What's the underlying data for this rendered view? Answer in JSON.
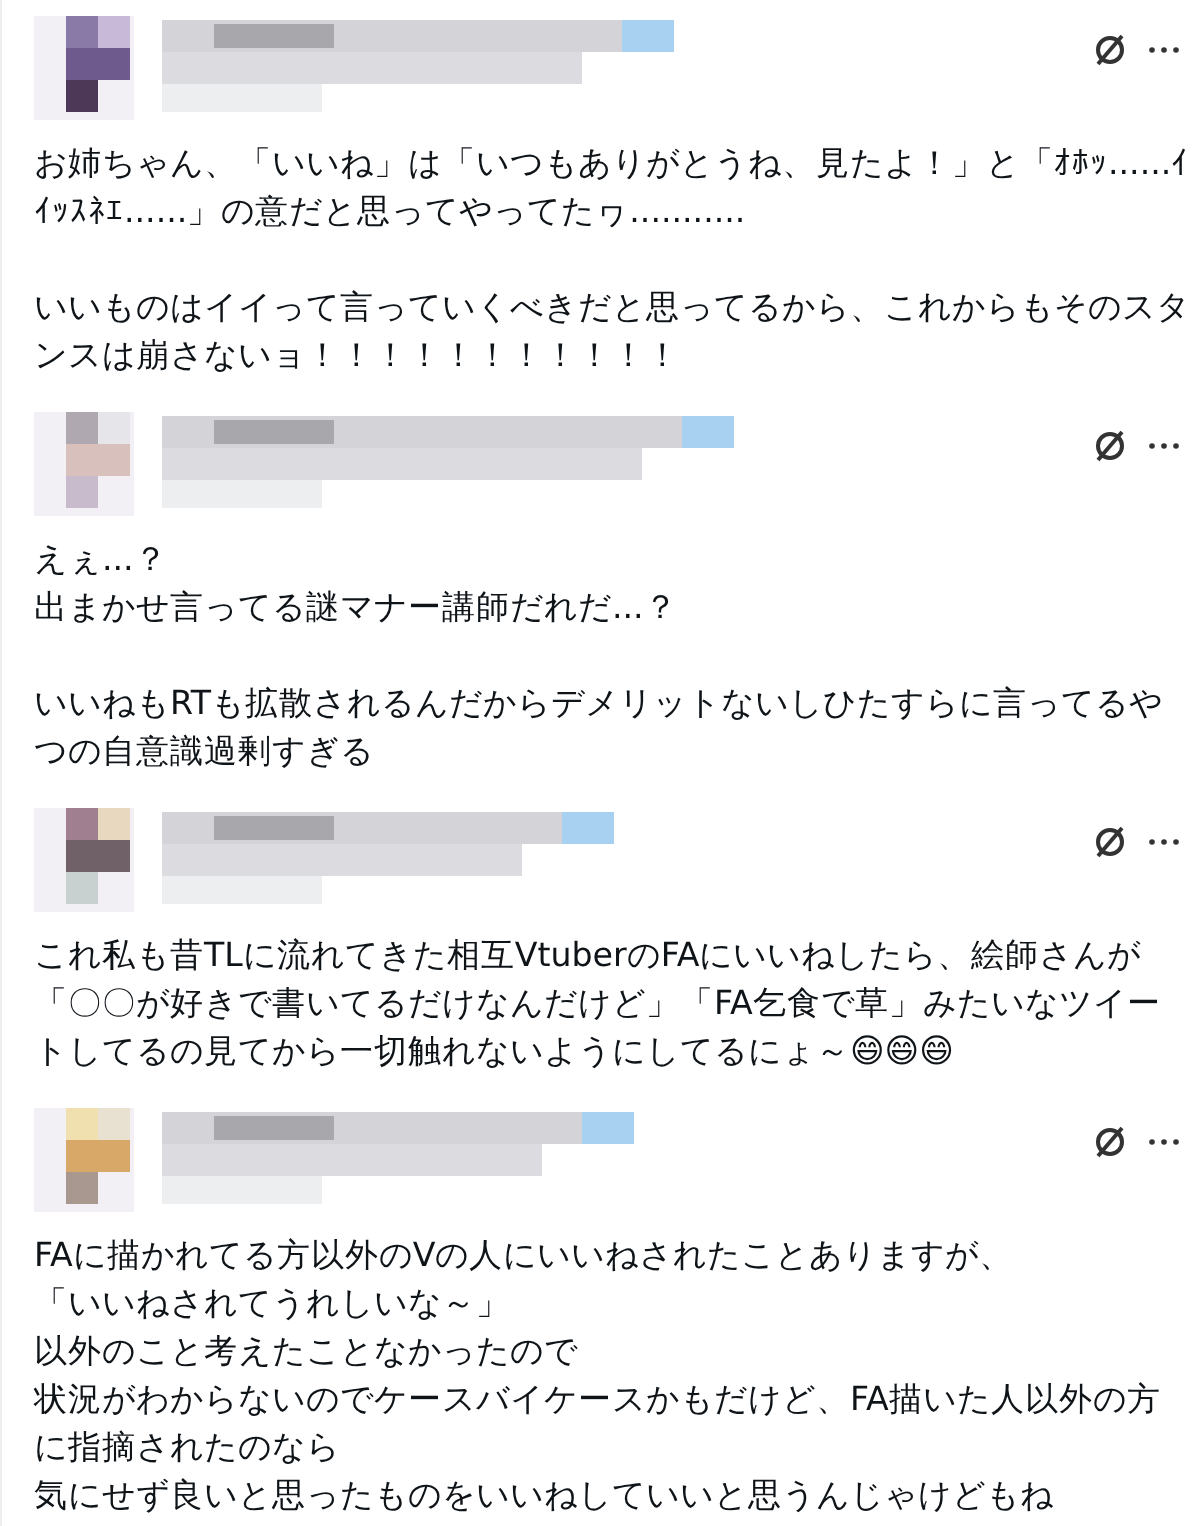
{
  "posts": [
    {
      "header": {
        "kind": "picture"
      },
      "paragraphs": [
        [
          "お姉ちゃん、「いいね」は「いつもありがとうね、見たよ！」と「ｵﾎｯ......ｲｲｯｽﾈｴ......」の意だと思ってやってたヮ..........."
        ],
        [
          "いいものはイイって言っていくべきだと思ってるから、これからもそのスタンスは崩さないョ！！！！！！！！！！！"
        ]
      ]
    },
    {
      "header": {
        "kind": "picture"
      },
      "paragraphs": [
        [
          "えぇ...？",
          "出まかせ言ってる謎マナー講師だれだ...？"
        ],
        [
          "いいねもRTも拡散されるんだからデメリットないしひたすらに言ってるやつの自意識過剰すぎる"
        ]
      ]
    },
    {
      "header": {
        "kind": "picture"
      },
      "paragraphs": [
        [
          "これ私も昔TLに流れてきた相互VtuberのFAにいいねしたら、絵師さんが「〇〇が好きで書いてるだけなんだけど」「FA乞食で草」みたいなツイートしてるの見てから一切触れないようにしてるにょ～😄😄😄"
        ]
      ]
    },
    {
      "header": {
        "kind": "picture"
      },
      "paragraphs": [
        [
          "FAに描かれてる方以外のVの人にいいねされたことありますが、",
          "「いいねされてうれしいな～」",
          "以外のこと考えたことなかったので",
          "状況がわからないのでケースバイケースかもだけど、FA描いた人以外の方に指摘されたのなら",
          "気にせず良いと思ったものをいいねしていいと思うんじゃけどもね"
        ]
      ]
    }
  ]
}
